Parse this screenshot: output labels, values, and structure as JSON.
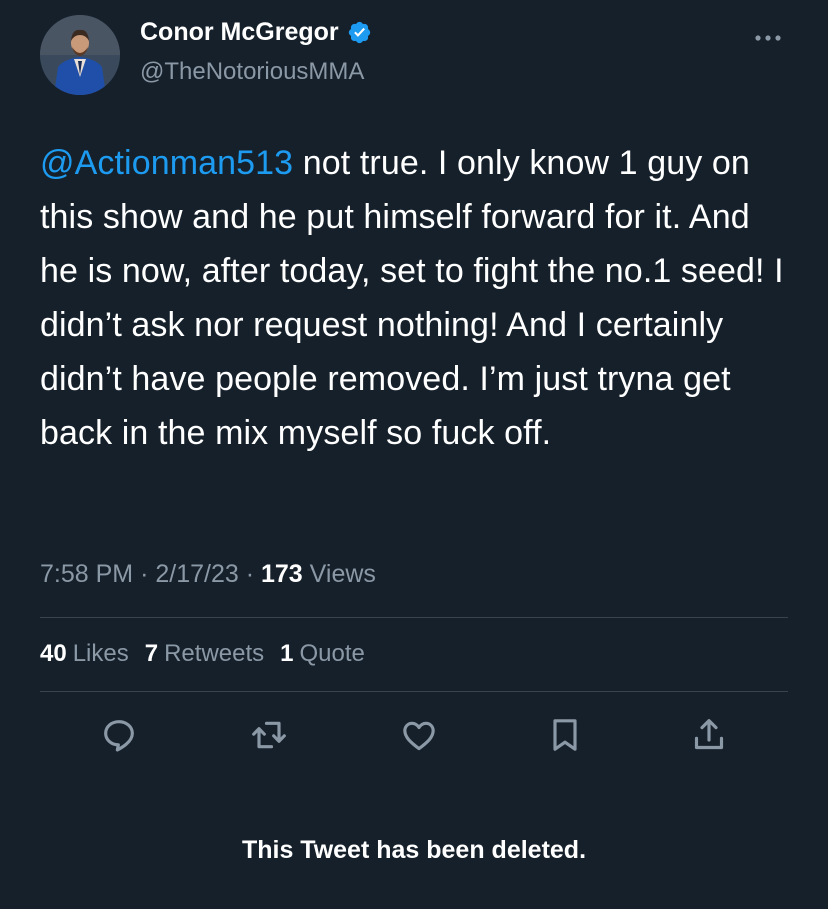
{
  "user": {
    "display_name": "Conor McGregor",
    "handle": "@TheNotoriousMMA",
    "verified": true
  },
  "tweet": {
    "mention": "@Actionman513",
    "body": " not true. I only know 1 guy on this show and he put himself forward for it. And he is now, after today, set to fight the no.1 seed! I didn’t ask nor request nothing! And I certainly didn’t have people removed. I’m just tryna get back in the mix myself so fuck off."
  },
  "meta": {
    "time": "7:58 PM",
    "date": "2/17/23",
    "separator": "·",
    "views_count": "173",
    "views_label": "Views"
  },
  "stats": {
    "likes_count": "40",
    "likes_label": "Likes",
    "retweets_count": "7",
    "retweets_label": "Retweets",
    "quotes_count": "1",
    "quotes_label": "Quote"
  },
  "notice": "This Tweet has been deleted.",
  "colors": {
    "background": "#15202b",
    "accent": "#1d9bf0",
    "secondary_text": "#8b98a5",
    "divider": "#38444d"
  },
  "icons": [
    "verified-badge-icon",
    "more-icon",
    "reply-icon",
    "retweet-icon",
    "like-icon",
    "bookmark-icon",
    "share-icon"
  ]
}
